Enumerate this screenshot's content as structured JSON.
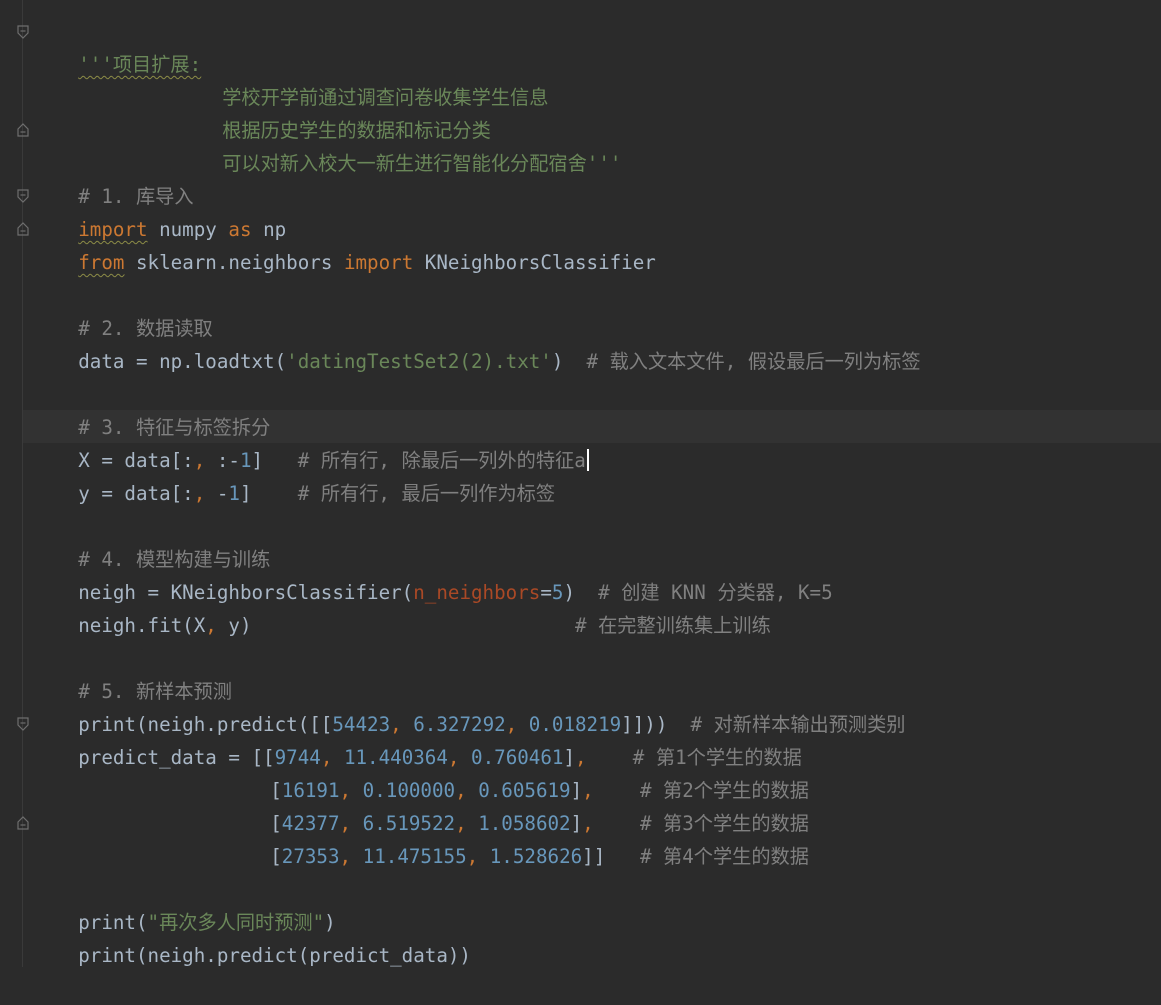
{
  "editor": {
    "lines": {
      "l1_quote": "'''",
      "l1_text": "项目扩展:",
      "l2": "学校开学前通过调查问卷收集学生信息",
      "l3": "根据历史学生的数据和标记分类",
      "l4": "可以对新入校大一新生进行智能化分配宿舍'''",
      "l5": "# 1. 库导入",
      "l6_kw1": "import",
      "l6_mid": " numpy ",
      "l6_kw2": "as",
      "l6_end": " np",
      "l7_kw1": "from",
      "l7_mid": " sklearn.neighbors ",
      "l7_kw2": "import",
      "l7_end": " KNeighborsClassifier",
      "l9": "# 2. 数据读取",
      "l10_a": "data = np.loadtxt(",
      "l10_str": "'datingTestSet2(2).txt'",
      "l10_b": ")  ",
      "l10_cmt": "# 载入文本文件, 假设最后一列为标签",
      "l12": "# 3. 特征与标签拆分",
      "l13_a": "X = data[:",
      "l13_comma": ",",
      "l13_b": " :-",
      "l13_num": "1",
      "l13_c": "]   ",
      "l13_cmt": "# 所有行, 除最后一列外的特征a",
      "l14_a": "y = data[:",
      "l14_comma": ",",
      "l14_b": " -",
      "l14_num": "1",
      "l14_c": "]    ",
      "l14_cmt": "# 所有行, 最后一列作为标签",
      "l16": "# 4. 模型构建与训练",
      "l17_a": "neigh = KNeighborsClassifier(",
      "l17_param": "n_neighbors",
      "l17_eq": "=",
      "l17_num": "5",
      "l17_b": ")  ",
      "l17_cmt": "# 创建 KNN 分类器, K=5",
      "l18_a": "neigh.fit(X",
      "l18_comma": ",",
      "l18_b": " y)                            ",
      "l18_cmt": "# 在完整训练集上训练",
      "l20": "# 5. 新样本预测",
      "l21_a": "print(neigh.predict([[",
      "l21_n1": "54423",
      "l21_c1": ",",
      "l21_n2": " 6.327292",
      "l21_c2": ",",
      "l21_n3": " 0.018219",
      "l21_b": "]]))  ",
      "l21_cmt": "# 对新样本输出预测类别",
      "l22_a": "predict_data = [[",
      "l22_n1": "9744",
      "l22_c1": ",",
      "l22_n2": " 11.440364",
      "l22_c2": ",",
      "l22_n3": " 0.760461",
      "l22_b": "]",
      "l22_c3": ",",
      "l22_sp": "    ",
      "l22_cmt": "# 第1个学生的数据",
      "l23_a": "[",
      "l23_n1": "16191",
      "l23_c1": ",",
      "l23_n2": " 0.100000",
      "l23_c2": ",",
      "l23_n3": " 0.605619",
      "l23_b": "]",
      "l23_c3": ",",
      "l23_sp": "    ",
      "l23_cmt": "# 第2个学生的数据",
      "l24_a": "[",
      "l24_n1": "42377",
      "l24_c1": ",",
      "l24_n2": " 6.519522",
      "l24_c2": ",",
      "l24_n3": " 1.058602",
      "l24_b": "]",
      "l24_c3": ",",
      "l24_sp": "    ",
      "l24_cmt": "# 第3个学生的数据",
      "l25_a": "[",
      "l25_n1": "27353",
      "l25_c1": ",",
      "l25_n2": " 11.475155",
      "l25_c2": ",",
      "l25_n3": " 1.528626",
      "l25_b": "]]   ",
      "l25_cmt": "# 第4个学生的数据",
      "l27_a": "print(",
      "l27_str": "\"再次多人同时预测\"",
      "l27_b": ")",
      "l28": "print(neigh.predict(predict_data))"
    }
  },
  "colors": {
    "background": "#2b2b2b",
    "keyword": "#cc7832",
    "string": "#6a8759",
    "number": "#6897bb",
    "comment": "#808080",
    "parameter": "#aa4926",
    "text": "#a9b7c6"
  },
  "icons": {
    "fold_open": "fold-open-icon",
    "fold_close": "fold-close-icon"
  }
}
